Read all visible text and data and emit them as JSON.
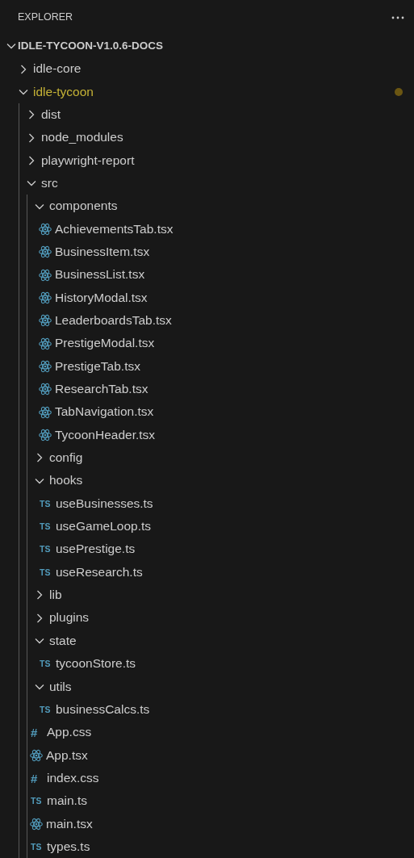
{
  "panel": {
    "title": "EXPLORER"
  },
  "tree": [
    {
      "kind": "folder",
      "name": "IDLE-TYCOON-V1.0.6-DOCS",
      "expanded": true,
      "root": true,
      "children": [
        {
          "kind": "folder",
          "name": "idle-core",
          "expanded": false
        },
        {
          "kind": "folder",
          "name": "idle-tycoon",
          "expanded": true,
          "modified": true,
          "children": [
            {
              "kind": "folder",
              "name": "dist",
              "expanded": false
            },
            {
              "kind": "folder",
              "name": "node_modules",
              "expanded": false
            },
            {
              "kind": "folder",
              "name": "playwright-report",
              "expanded": false
            },
            {
              "kind": "folder",
              "name": "src",
              "expanded": true,
              "children": [
                {
                  "kind": "folder",
                  "name": "components",
                  "expanded": true,
                  "children": [
                    {
                      "kind": "react",
                      "name": "AchievementsTab.tsx"
                    },
                    {
                      "kind": "react",
                      "name": "BusinessItem.tsx"
                    },
                    {
                      "kind": "react",
                      "name": "BusinessList.tsx"
                    },
                    {
                      "kind": "react",
                      "name": "HistoryModal.tsx"
                    },
                    {
                      "kind": "react",
                      "name": "LeaderboardsTab.tsx"
                    },
                    {
                      "kind": "react",
                      "name": "PrestigeModal.tsx"
                    },
                    {
                      "kind": "react",
                      "name": "PrestigeTab.tsx"
                    },
                    {
                      "kind": "react",
                      "name": "ResearchTab.tsx"
                    },
                    {
                      "kind": "react",
                      "name": "TabNavigation.tsx"
                    },
                    {
                      "kind": "react",
                      "name": "TycoonHeader.tsx"
                    }
                  ]
                },
                {
                  "kind": "folder",
                  "name": "config",
                  "expanded": false
                },
                {
                  "kind": "folder",
                  "name": "hooks",
                  "expanded": true,
                  "children": [
                    {
                      "kind": "ts",
                      "icon": "TS",
                      "name": "useBusinesses.ts"
                    },
                    {
                      "kind": "ts",
                      "icon": "TS",
                      "name": "useGameLoop.ts"
                    },
                    {
                      "kind": "ts",
                      "icon": "TS",
                      "name": "usePrestige.ts"
                    },
                    {
                      "kind": "ts",
                      "icon": "TS",
                      "name": "useResearch.ts"
                    }
                  ]
                },
                {
                  "kind": "folder",
                  "name": "lib",
                  "expanded": false
                },
                {
                  "kind": "folder",
                  "name": "plugins",
                  "expanded": false
                },
                {
                  "kind": "folder",
                  "name": "state",
                  "expanded": true,
                  "children": [
                    {
                      "kind": "ts",
                      "icon": "TS",
                      "name": "tycoonStore.ts"
                    }
                  ]
                },
                {
                  "kind": "folder",
                  "name": "utils",
                  "expanded": true,
                  "children": [
                    {
                      "kind": "ts",
                      "icon": "TS",
                      "name": "businessCalcs.ts"
                    }
                  ]
                },
                {
                  "kind": "css",
                  "icon": "#",
                  "name": "App.css"
                },
                {
                  "kind": "react",
                  "name": "App.tsx"
                },
                {
                  "kind": "css",
                  "icon": "#",
                  "name": "index.css"
                },
                {
                  "kind": "ts",
                  "icon": "TS",
                  "name": "main.ts"
                },
                {
                  "kind": "react",
                  "name": "main.tsx"
                },
                {
                  "kind": "ts",
                  "icon": "TS",
                  "name": "types.ts"
                }
              ]
            }
          ]
        }
      ]
    }
  ]
}
